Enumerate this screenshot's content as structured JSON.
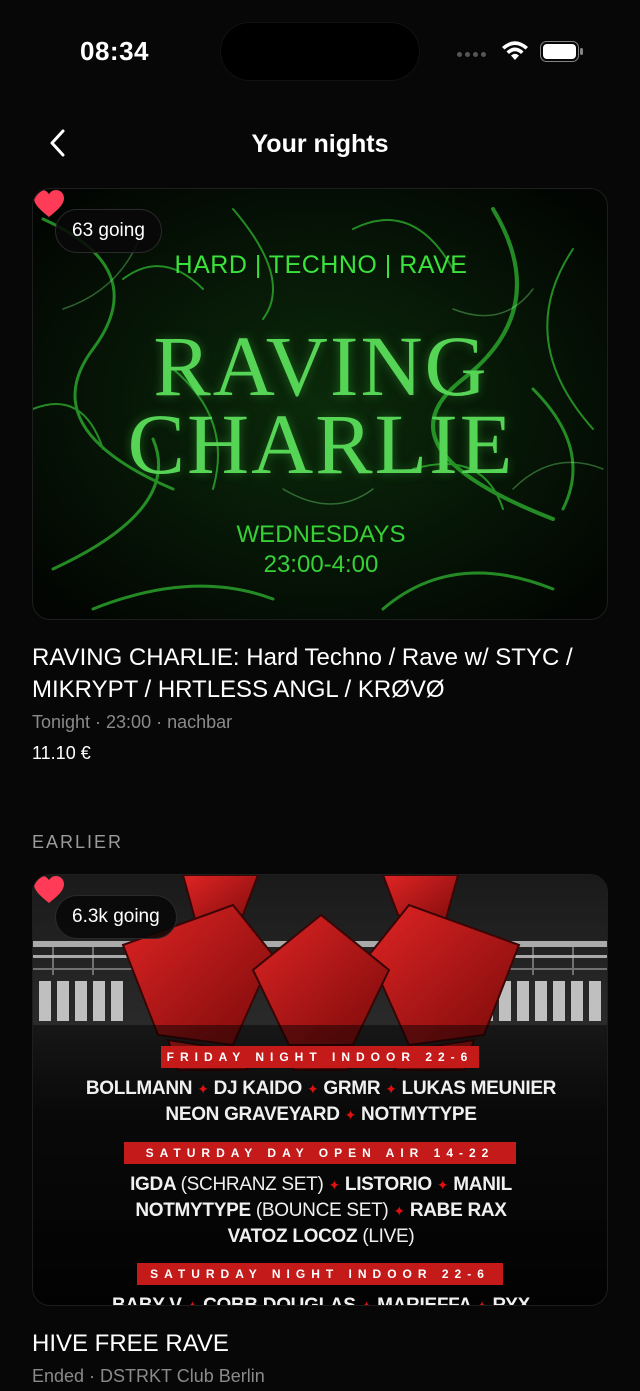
{
  "status": {
    "time": "08:34"
  },
  "header": {
    "title": "Your nights"
  },
  "events": [
    {
      "going": "63 going",
      "poster": {
        "genre": "HARD | TECHNO | RAVE",
        "name_line1": "RAVING",
        "name_line2": "CHARLIE",
        "days": "WEDNESDAYS",
        "hours": "23:00-4:00"
      },
      "title": "RAVING CHARLIE: Hard Techno / Rave w/ STYC / MIKRYPT / HRTLESS ANGL / KRØVØ",
      "meta": "Tonight · 23:00 · nachbar",
      "price": "11.10 €"
    }
  ],
  "section_label": "EARLIER",
  "past_events": [
    {
      "going": "6.3k going",
      "poster": {
        "band1": "FRIDAY NIGHT INDOOR 22-6",
        "row1": [
          "BOLLMANN",
          "DJ KAIDO",
          "GRMR",
          "LUKAS MEUNIER"
        ],
        "row2": [
          "NEON GRAVEYARD",
          "NOTMYTYPE"
        ],
        "band2": "SATURDAY DAY OPEN AIR 14-22",
        "row3a": "IGDA",
        "row3a_note": "(SCHRANZ SET)",
        "row3b": [
          "LISTORIO",
          "MANIL"
        ],
        "row4a": "NOTMYTYPE",
        "row4a_note": "(BOUNCE SET)",
        "row4b": "RABE RAX",
        "row5": "VATOZ LOCOZ",
        "row5_note": "(LIVE)",
        "band3": "SATURDAY NIGHT INDOOR 22-6",
        "row6": [
          "BABY V",
          "COBB DOUGLAS",
          "MARIEFFA",
          "RYX"
        ]
      },
      "title": "HIVE FREE RAVE",
      "meta": "Ended · DSTRKT Club Berlin"
    }
  ],
  "colors": {
    "accent_heart": "#ff3b57",
    "green": "#3be23b",
    "red": "#c41a1a"
  }
}
